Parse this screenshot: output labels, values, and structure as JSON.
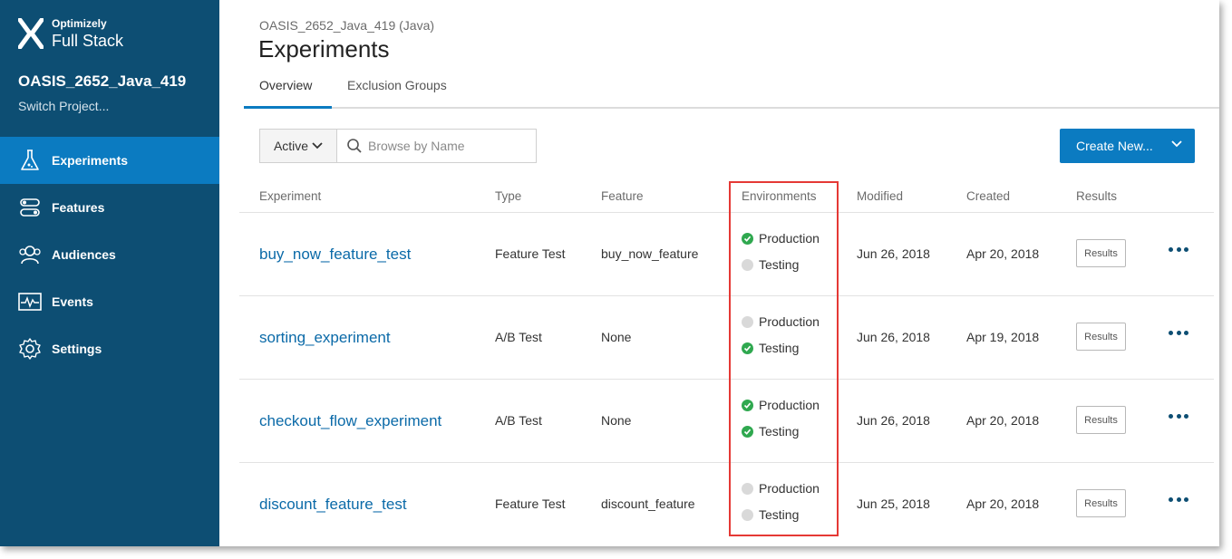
{
  "brand": {
    "small": "Optimizely",
    "big": "Full Stack"
  },
  "sidebar": {
    "project_name": "OASIS_2652_Java_419",
    "switch_label": "Switch Project...",
    "items": [
      {
        "label": "Experiments",
        "icon": "flask-icon",
        "active": true
      },
      {
        "label": "Features",
        "icon": "toggle-icon",
        "active": false
      },
      {
        "label": "Audiences",
        "icon": "people-icon",
        "active": false
      },
      {
        "label": "Events",
        "icon": "pulse-icon",
        "active": false
      },
      {
        "label": "Settings",
        "icon": "gear-icon",
        "active": false
      }
    ]
  },
  "header": {
    "project_label": "OASIS_2652_Java_419 (Java)",
    "title": "Experiments",
    "tabs": [
      "Overview",
      "Exclusion Groups"
    ]
  },
  "toolbar": {
    "filter_label": "Active",
    "search_placeholder": "Browse by Name",
    "create_label": "Create New..."
  },
  "table": {
    "columns": [
      "Experiment",
      "Type",
      "Feature",
      "Environments",
      "Modified",
      "Created",
      "Results"
    ],
    "rows": [
      {
        "name": "buy_now_feature_test",
        "type": "Feature Test",
        "feature": "buy_now_feature",
        "env": [
          {
            "label": "Production",
            "on": true
          },
          {
            "label": "Testing",
            "on": false
          }
        ],
        "modified": "Jun 26, 2018",
        "created": "Apr 20, 2018",
        "results": "Results"
      },
      {
        "name": "sorting_experiment",
        "type": "A/B Test",
        "feature": "None",
        "env": [
          {
            "label": "Production",
            "on": false
          },
          {
            "label": "Testing",
            "on": true
          }
        ],
        "modified": "Jun 26, 2018",
        "created": "Apr 19, 2018",
        "results": "Results"
      },
      {
        "name": "checkout_flow_experiment",
        "type": "A/B Test",
        "feature": "None",
        "env": [
          {
            "label": "Production",
            "on": true
          },
          {
            "label": "Testing",
            "on": true
          }
        ],
        "modified": "Jun 26, 2018",
        "created": "Apr 20, 2018",
        "results": "Results"
      },
      {
        "name": "discount_feature_test",
        "type": "Feature Test",
        "feature": "discount_feature",
        "env": [
          {
            "label": "Production",
            "on": false
          },
          {
            "label": "Testing",
            "on": false
          }
        ],
        "modified": "Jun 25, 2018",
        "created": "Apr 20, 2018",
        "results": "Results"
      }
    ]
  },
  "colors": {
    "sidebar": "#0d4e73",
    "accent": "#0b7bc1",
    "link": "#0b6aa8",
    "env_on": "#2fa84f",
    "env_off": "#d9d9d9",
    "highlight": "#e53935"
  }
}
